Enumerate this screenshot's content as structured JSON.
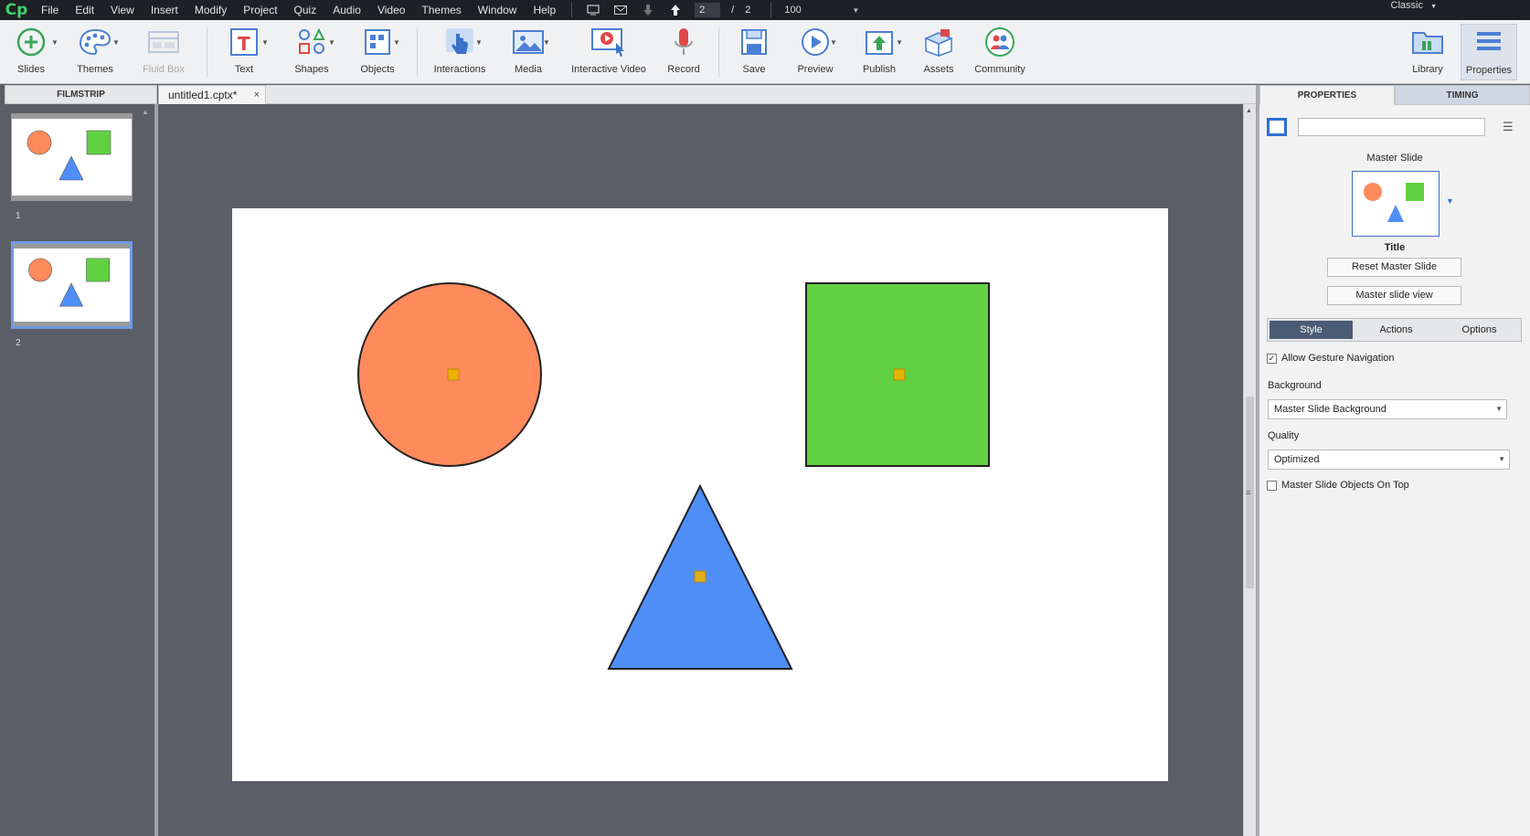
{
  "app": {
    "logo": "Cp",
    "menus": [
      "File",
      "Edit",
      "View",
      "Insert",
      "Modify",
      "Project",
      "Quiz",
      "Audio",
      "Video",
      "Themes",
      "Window",
      "Help"
    ],
    "current_slide": "2",
    "slide_separator": "/",
    "total_slides": "2",
    "zoom": "100",
    "workspace": "Classic"
  },
  "toolbar": {
    "slides": "Slides",
    "themes": "Themes",
    "fluid_box": "Fluid Box",
    "text": "Text",
    "shapes": "Shapes",
    "objects": "Objects",
    "interactions": "Interactions",
    "media": "Media",
    "interactive_video": "Interactive Video",
    "record": "Record",
    "save": "Save",
    "preview": "Preview",
    "publish": "Publish",
    "assets": "Assets",
    "community": "Community",
    "library": "Library",
    "properties": "Properties"
  },
  "filmstrip": {
    "header": "FILMSTRIP",
    "slides": [
      {
        "number": "1"
      },
      {
        "number": "2"
      }
    ]
  },
  "document": {
    "tab_title": "untitled1.cptx*",
    "close_glyph": "×"
  },
  "stage": {
    "shapes": {
      "circle_color": "#ff8a5c",
      "square_color": "#62d043",
      "triangle_color": "#4f8ef7",
      "outline_color": "#222222"
    }
  },
  "properties": {
    "tab_properties": "PROPERTIES",
    "tab_timing": "TIMING",
    "name_value": "",
    "master_slide_heading": "Master Slide",
    "master_slide_name": "Title",
    "reset_master_slide": "Reset Master Slide",
    "master_slide_view": "Master slide view",
    "subtabs": [
      "Style",
      "Actions",
      "Options"
    ],
    "allow_gesture_navigation": "Allow Gesture Navigation",
    "background_label": "Background",
    "background_value": "Master Slide Background",
    "quality_label": "Quality",
    "quality_value": "Optimized",
    "master_objects_on_top": "Master Slide Objects On Top"
  }
}
